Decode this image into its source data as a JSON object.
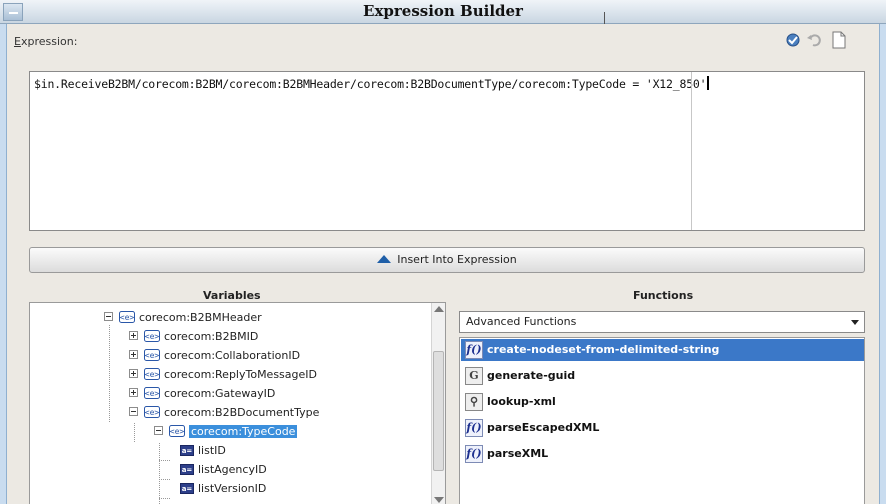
{
  "window": {
    "title": "Expression Builder"
  },
  "expression": {
    "label_prefix": "E",
    "label_rest": "xpression:",
    "value": "$in.ReceiveB2BM/corecom:B2BM/corecom:B2BMHeader/corecom:B2BDocumentType/corecom:TypeCode = 'X12_850'"
  },
  "toolbar": {
    "icons": [
      "check-syntax-icon",
      "undo-icon",
      "new-document-icon"
    ]
  },
  "insert_button": {
    "label": "Insert Into Expression"
  },
  "variables": {
    "header": "Variables",
    "tree": [
      {
        "label": "corecom:B2BMHeader",
        "expanded": true
      },
      {
        "label": "corecom:B2BMID",
        "expanded": false
      },
      {
        "label": "corecom:CollaborationID",
        "expanded": false
      },
      {
        "label": "corecom:ReplyToMessageID",
        "expanded": false
      },
      {
        "label": "corecom:GatewayID",
        "expanded": false
      },
      {
        "label": "corecom:B2BDocumentType",
        "expanded": true
      },
      {
        "label": "corecom:TypeCode",
        "expanded": true,
        "selected": true
      },
      {
        "label": "listID"
      },
      {
        "label": "listAgencyID"
      },
      {
        "label": "listVersionID"
      }
    ]
  },
  "functions": {
    "header": "Functions",
    "category": "Advanced Functions",
    "items": [
      {
        "label": "create-nodeset-from-delimited-string",
        "icon": "f()",
        "selected": true
      },
      {
        "label": "generate-guid",
        "icon": "guid"
      },
      {
        "label": "lookup-xml",
        "icon": "lookup"
      },
      {
        "label": "parseEscapedXML",
        "icon": "f()"
      },
      {
        "label": "parseXML",
        "icon": "f()"
      }
    ]
  },
  "colors": {
    "selection": "#3b78c8",
    "tree_selection": "#3b8fdc",
    "titlebar": "#c9d6e2"
  }
}
